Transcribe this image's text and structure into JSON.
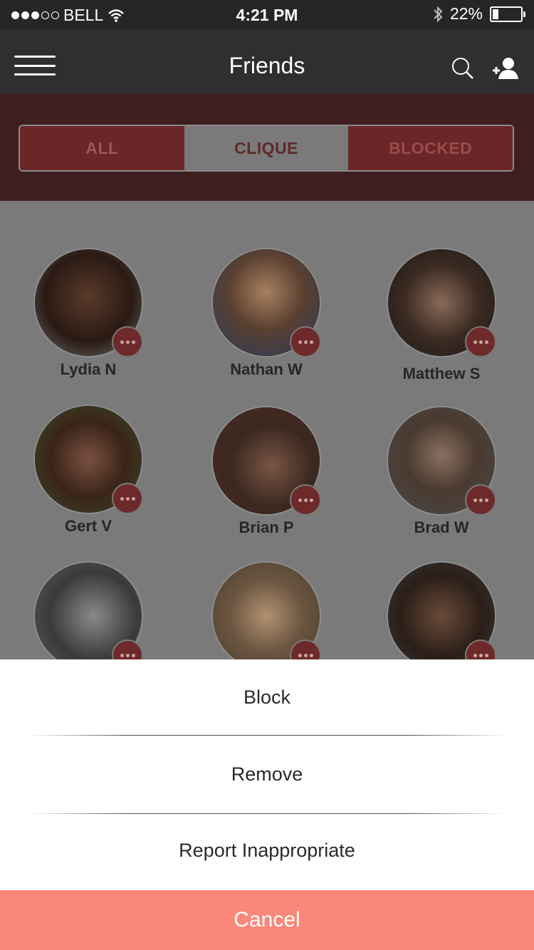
{
  "status_bar": {
    "carrier": "BELL",
    "time": "4:21 PM",
    "battery": "22%",
    "battery_level": 0.22
  },
  "navbar": {
    "title": "Friends"
  },
  "tabs": [
    {
      "label": "ALL"
    },
    {
      "label": "CLIQUE"
    },
    {
      "label": "BLOCKED"
    }
  ],
  "friends": [
    {
      "name": "Lydia N"
    },
    {
      "name": "Nathan W"
    },
    {
      "name": "Matthew S"
    },
    {
      "name": "Gert V"
    },
    {
      "name": "Brian P"
    },
    {
      "name": "Brad W"
    },
    {
      "name": ""
    },
    {
      "name": ""
    },
    {
      "name": ""
    }
  ],
  "action_sheet": {
    "actions": [
      {
        "label": "Block"
      },
      {
        "label": "Remove"
      },
      {
        "label": "Report Inappropriate"
      }
    ],
    "cancel": "Cancel"
  },
  "colors": {
    "accent": "#fb877a",
    "nav": "#2f2f2f",
    "segment_active": "#6b2627"
  }
}
